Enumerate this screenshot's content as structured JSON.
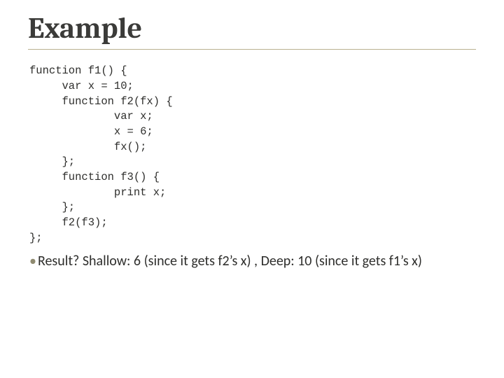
{
  "title": "Example",
  "code": "function f1() {\n     var x = 10;\n     function f2(fx) {\n             var x;\n             x = 6;\n             fx();\n     };\n     function f3() {\n             print x;\n     };\n     f2(f3);\n};",
  "result": {
    "bullet": "•",
    "text": "Result?  Shallow: 6 (since it gets f2’s x) , Deep: 10 (since it gets f1’s x)"
  }
}
